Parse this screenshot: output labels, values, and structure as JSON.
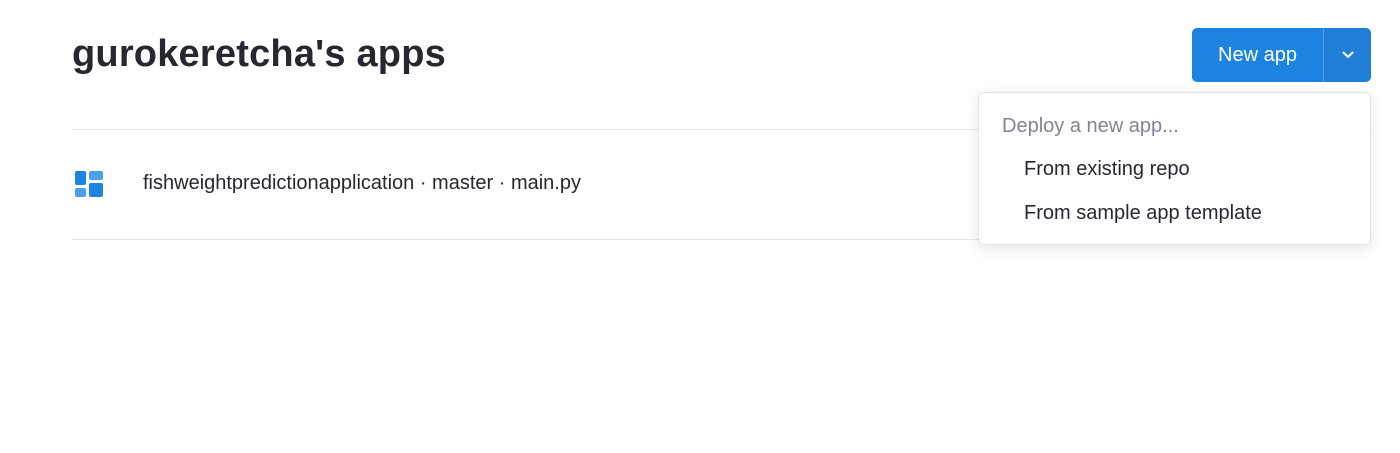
{
  "header": {
    "title": "gurokeretcha's apps"
  },
  "new_app": {
    "label": "New app",
    "toggle_icon": "chevron-down-icon",
    "accent_color": "#1c83e1"
  },
  "apps": [
    {
      "icon": "dashboard-icon",
      "label": "fishweightpredictionapplication · master · main.py"
    }
  ],
  "dropdown": {
    "header": "Deploy a new app...",
    "items": [
      {
        "label": "From existing repo"
      },
      {
        "label": "From sample app template"
      }
    ]
  }
}
